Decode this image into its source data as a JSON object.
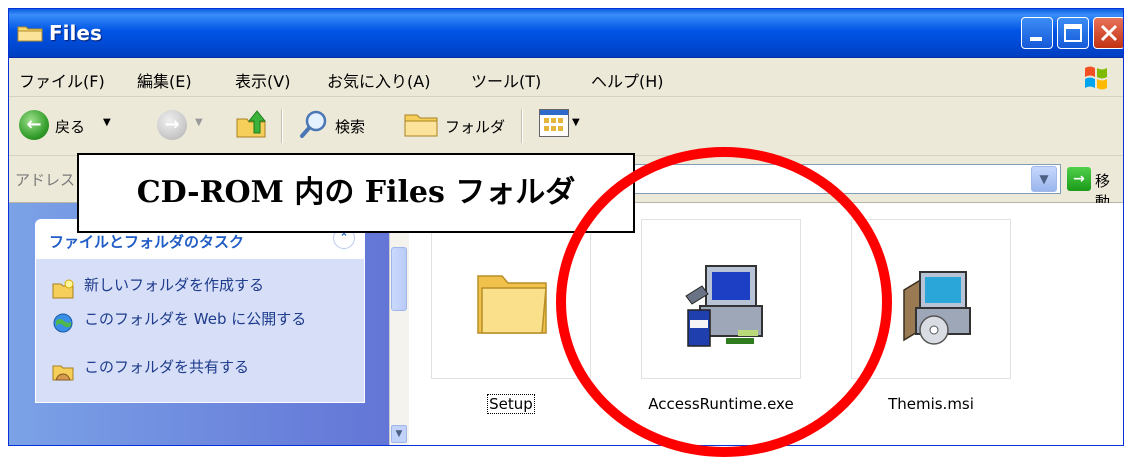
{
  "window": {
    "title": "Files",
    "buttons": [
      "minimize",
      "maximize",
      "close"
    ]
  },
  "menu": {
    "items": [
      "ファイル(F)",
      "編集(E)",
      "表示(V)",
      "お気に入り(A)",
      "ツール(T)",
      "ヘルプ(H)"
    ]
  },
  "toolbar": {
    "back_label": "戻る",
    "search_label": "検索",
    "folders_label": "フォルダ"
  },
  "address": {
    "label": "アドレス",
    "go_label": "移動"
  },
  "tasks": {
    "title": "ファイルとフォルダのタスク",
    "items": [
      {
        "label": "新しいフォルダを作成する",
        "icon": "new-folder-icon"
      },
      {
        "label": "このフォルダを Web に公開する",
        "icon": "publish-web-icon"
      },
      {
        "label": "このフォルダを共有する",
        "icon": "share-folder-icon"
      }
    ]
  },
  "files": [
    {
      "name": "Setup",
      "icon": "folder-icon",
      "focused": true
    },
    {
      "name": "AccessRuntime.exe",
      "icon": "setup-program-icon"
    },
    {
      "name": "Themis.msi",
      "icon": "installer-package-icon"
    }
  ],
  "annotation": {
    "text": "CD-ROM 内の Files フォルダ",
    "highlight_color": "#ff0000"
  },
  "colors": {
    "titlebar": "#0055e5",
    "taskpane": "#7ba2e7",
    "task_text": "#215dc6"
  }
}
